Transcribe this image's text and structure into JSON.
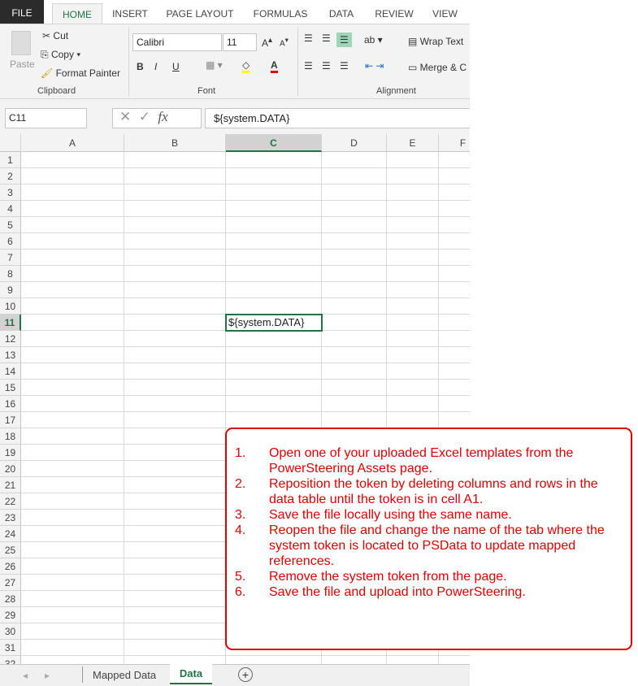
{
  "ribbon": {
    "tabs": [
      "FILE",
      "HOME",
      "INSERT",
      "PAGE LAYOUT",
      "FORMULAS",
      "DATA",
      "REVIEW",
      "VIEW"
    ],
    "active_tab": "HOME",
    "clipboard": {
      "paste": "Paste",
      "cut": "Cut",
      "copy": "Copy",
      "format_painter": "Format Painter",
      "label": "Clipboard"
    },
    "font": {
      "name": "Calibri",
      "size": "11",
      "bold": "B",
      "italic": "I",
      "underline": "U",
      "label": "Font"
    },
    "alignment": {
      "wrap_text": "Wrap Text",
      "merge": "Merge & C",
      "label": "Alignment"
    }
  },
  "formula_bar": {
    "name_box": "C11",
    "fx": "fx",
    "value": "${system.DATA}"
  },
  "grid": {
    "columns": [
      "A",
      "B",
      "C",
      "D",
      "E",
      "F"
    ],
    "selected_column": "C",
    "rows": [
      "1",
      "2",
      "3",
      "4",
      "5",
      "6",
      "7",
      "8",
      "9",
      "10",
      "11",
      "12",
      "13",
      "14",
      "15",
      "16",
      "17",
      "18",
      "19",
      "20",
      "21",
      "22",
      "23",
      "24",
      "25",
      "26",
      "27",
      "28",
      "29",
      "30",
      "31"
    ],
    "selected_row": "11",
    "cell_c11": "${system.DATA}"
  },
  "sheets": {
    "tabs": [
      "Mapped Data",
      "Data"
    ],
    "active": "Data"
  },
  "callout": {
    "color": "#e00000",
    "steps": [
      {
        "n": "1.",
        "text": "Open one of your uploaded Excel templates from the PowerSteering Assets page."
      },
      {
        "n": "2.",
        "text": "Reposition the token by deleting columns and rows in the data table until the token is in cell A1."
      },
      {
        "n": "3.",
        "text": "Save the file locally using the same name."
      },
      {
        "n": "4.",
        "text": "Reopen the file and change the name of the tab where the system token is located to PSData to update mapped references."
      },
      {
        "n": "5.",
        "text": "Remove the system token from the page."
      },
      {
        "n": "6.",
        "text": "Save the file and upload into PowerSteering."
      }
    ]
  }
}
